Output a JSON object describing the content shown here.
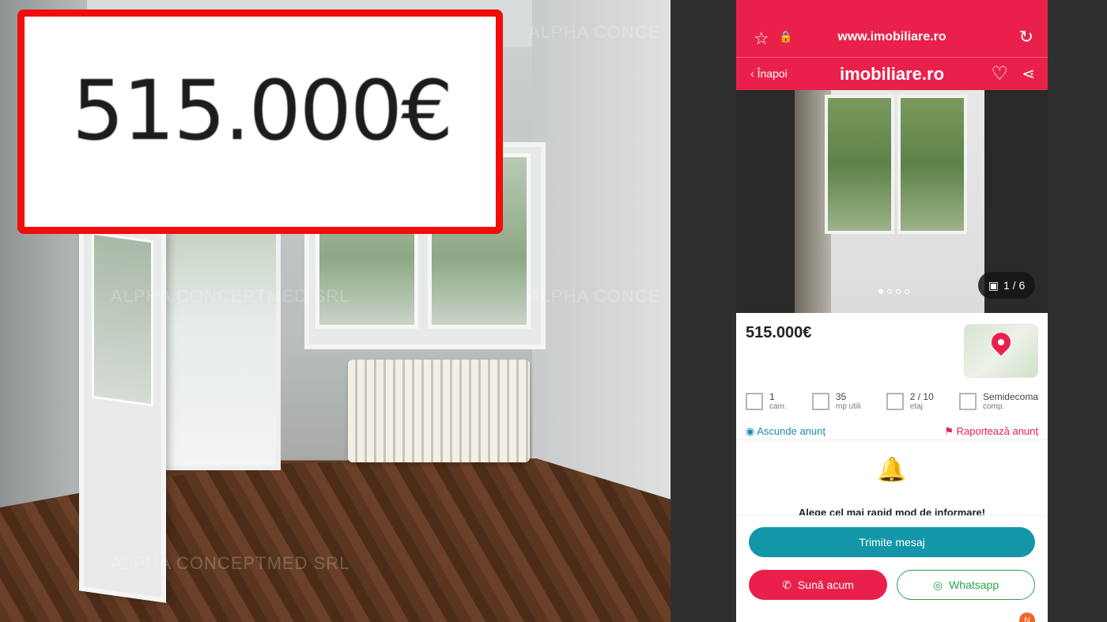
{
  "callout": {
    "price": "515.000€"
  },
  "watermarks": [
    "ALPHA CONCE",
    "ALPHA CONCEPTMED SRL",
    "ALPHA CONCE",
    "ALPHA CONCEPTMED SRL"
  ],
  "browser": {
    "url": "www.imobiliare.ro"
  },
  "site": {
    "back_label": "Înapoi",
    "logo": "imobiliare.ro"
  },
  "gallery": {
    "counter": "1 / 6",
    "current": 1,
    "total": 6
  },
  "listing": {
    "price": "515.000€",
    "specs": [
      {
        "value": "1",
        "label": "cam."
      },
      {
        "value": "35",
        "label": "mp utili"
      },
      {
        "value": "2 / 10",
        "label": "etaj"
      },
      {
        "value": "Semidecoma",
        "label": "comp."
      }
    ],
    "hide_label": "Ascunde anunț",
    "report_label": "Raportează anunț"
  },
  "notify": {
    "text": "Alege cel mai rapid mod de informare!"
  },
  "buttons": {
    "message": "Trimite mesaj",
    "call": "Sună acum",
    "whatsapp": "Whatsapp"
  },
  "badge": "N",
  "colors": {
    "brand": "#e9214a",
    "teal": "#1396a8",
    "whatsapp": "#2aa34d",
    "callout_border": "#f20d0d"
  }
}
